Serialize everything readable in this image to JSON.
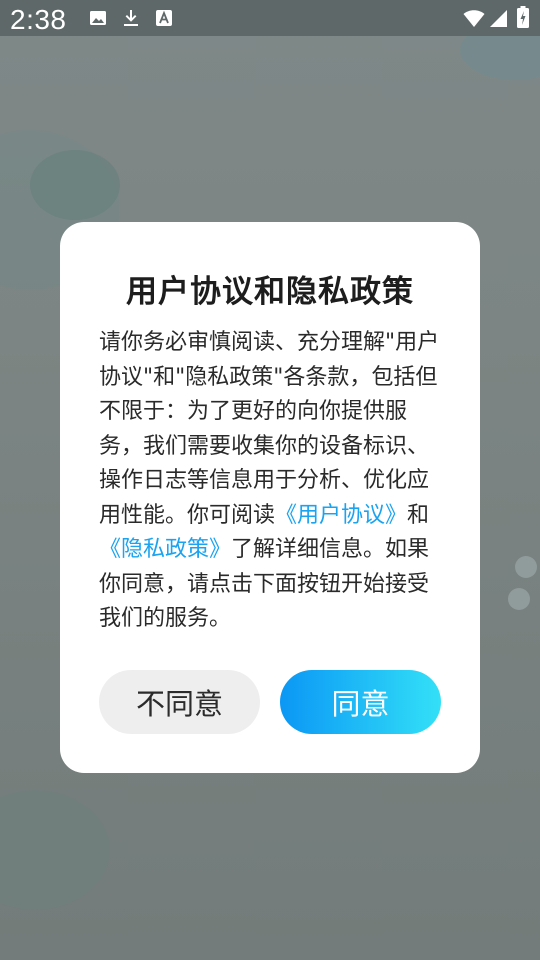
{
  "status_bar": {
    "time": "2:38",
    "icons": [
      "image-icon",
      "download-icon",
      "font-icon",
      "wifi-icon",
      "signal-icon",
      "battery-icon"
    ]
  },
  "dialog": {
    "title": "用户协议和隐私政策",
    "body_prefix": "请你务必审慎阅读、充分理解\"用户协议\"和\"隐私政策\"各条款，包括但不限于：为了更好的向你提供服务，我们需要收集你的设备标识、操作日志等信息用于分析、优化应用性能。你可阅读",
    "link_user_agreement": "《用户协议》",
    "conjunction": "和",
    "link_privacy_policy": "《隐私政策》",
    "body_suffix": "了解详细信息。如果你同意，请点击下面按钮开始接受我们的服务。",
    "disagree_label": "不同意",
    "agree_label": "同意"
  },
  "colors": {
    "link": "#1aa3f0",
    "agree_gradient_start": "#0b97f5",
    "agree_gradient_end": "#33e0f7",
    "disagree_bg": "#eeeeee"
  }
}
